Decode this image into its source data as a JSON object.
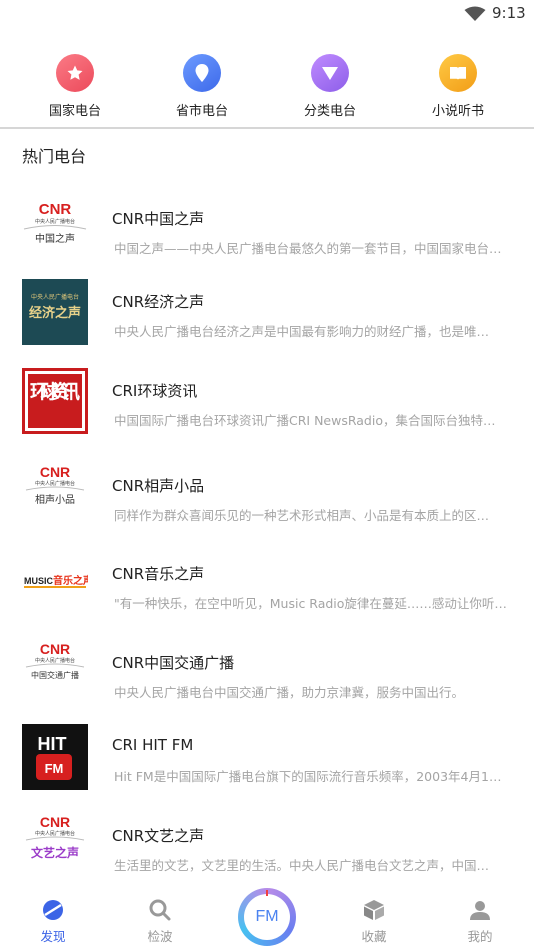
{
  "status": {
    "time": "9:13"
  },
  "categories": [
    {
      "label": "国家电台",
      "icon": "star-icon",
      "color": "#f15b6a"
    },
    {
      "label": "省市电台",
      "icon": "location-pin-icon",
      "color": "#4f7ff5"
    },
    {
      "label": "分类电台",
      "icon": "triangle-down-icon",
      "color": "#a46ef0"
    },
    {
      "label": "小说听书",
      "icon": "book-icon",
      "color": "#f6b22b"
    }
  ],
  "section_title": "热门电台",
  "stations": [
    {
      "name": "CNR中国之声",
      "desc": "中国之声——中央人民广播电台最悠久的第一套节目，中国国家电台…",
      "logo": {
        "title": "CNR",
        "subtitle": "中央人民广播电台",
        "caption": "中国之声"
      }
    },
    {
      "name": "CNR经济之声",
      "desc": "中央人民广播电台经济之声是中国最有影响力的财经广播，也是唯…",
      "logo": {
        "title": "中央人民广播电台",
        "caption": "经济之声"
      }
    },
    {
      "name": "CRI环球资讯",
      "desc": "中国国际广播电台环球资讯广播CRI NewsRadio，集合国际台独特…",
      "logo": {
        "caption": "环球资讯"
      }
    },
    {
      "name": "CNR相声小品",
      "desc": "同样作为群众喜闻乐见的一种艺术形式相声、小品是有本质上的区…",
      "logo": {
        "title": "CNR",
        "subtitle": "中央人民广播电台",
        "caption": "相声小品"
      }
    },
    {
      "name": "CNR音乐之声",
      "desc": "\"有一种快乐，在空中听见，Music Radio旋律在蔓延……感动让你听…",
      "logo": {
        "title": "MUSIC",
        "caption": "音乐之声"
      }
    },
    {
      "name": "CNR中国交通广播",
      "desc": "中央人民广播电台中国交通广播，助力京津冀，服务中国出行。",
      "logo": {
        "title": "CNR",
        "subtitle": "中央人民广播电台",
        "caption": "中国交通广播"
      }
    },
    {
      "name": "CRI HIT FM",
      "desc": "Hit FM是中国国际广播电台旗下的国际流行音乐频率，2003年4月1…",
      "logo": {
        "title": "HIT",
        "caption": "FM"
      }
    },
    {
      "name": "CNR文艺之声",
      "desc": "生活里的文艺，文艺里的生活。中央人民广播电台文艺之声，中国…",
      "logo": {
        "title": "CNR",
        "subtitle": "中央人民广播电台",
        "caption": "文艺之声"
      }
    }
  ],
  "tabs": [
    {
      "label": "发现",
      "icon": "discover-icon",
      "active": true
    },
    {
      "label": "检波",
      "icon": "search-icon",
      "active": false
    },
    {
      "label": "FM",
      "icon": "fm-dial-icon",
      "active": false
    },
    {
      "label": "收藏",
      "icon": "box-icon",
      "active": false
    },
    {
      "label": "我的",
      "icon": "user-icon",
      "active": false
    }
  ],
  "colors": {
    "accent": "#3c64e6",
    "cnr_red": "#d7201f",
    "muted_text": "#a4a4a4"
  }
}
